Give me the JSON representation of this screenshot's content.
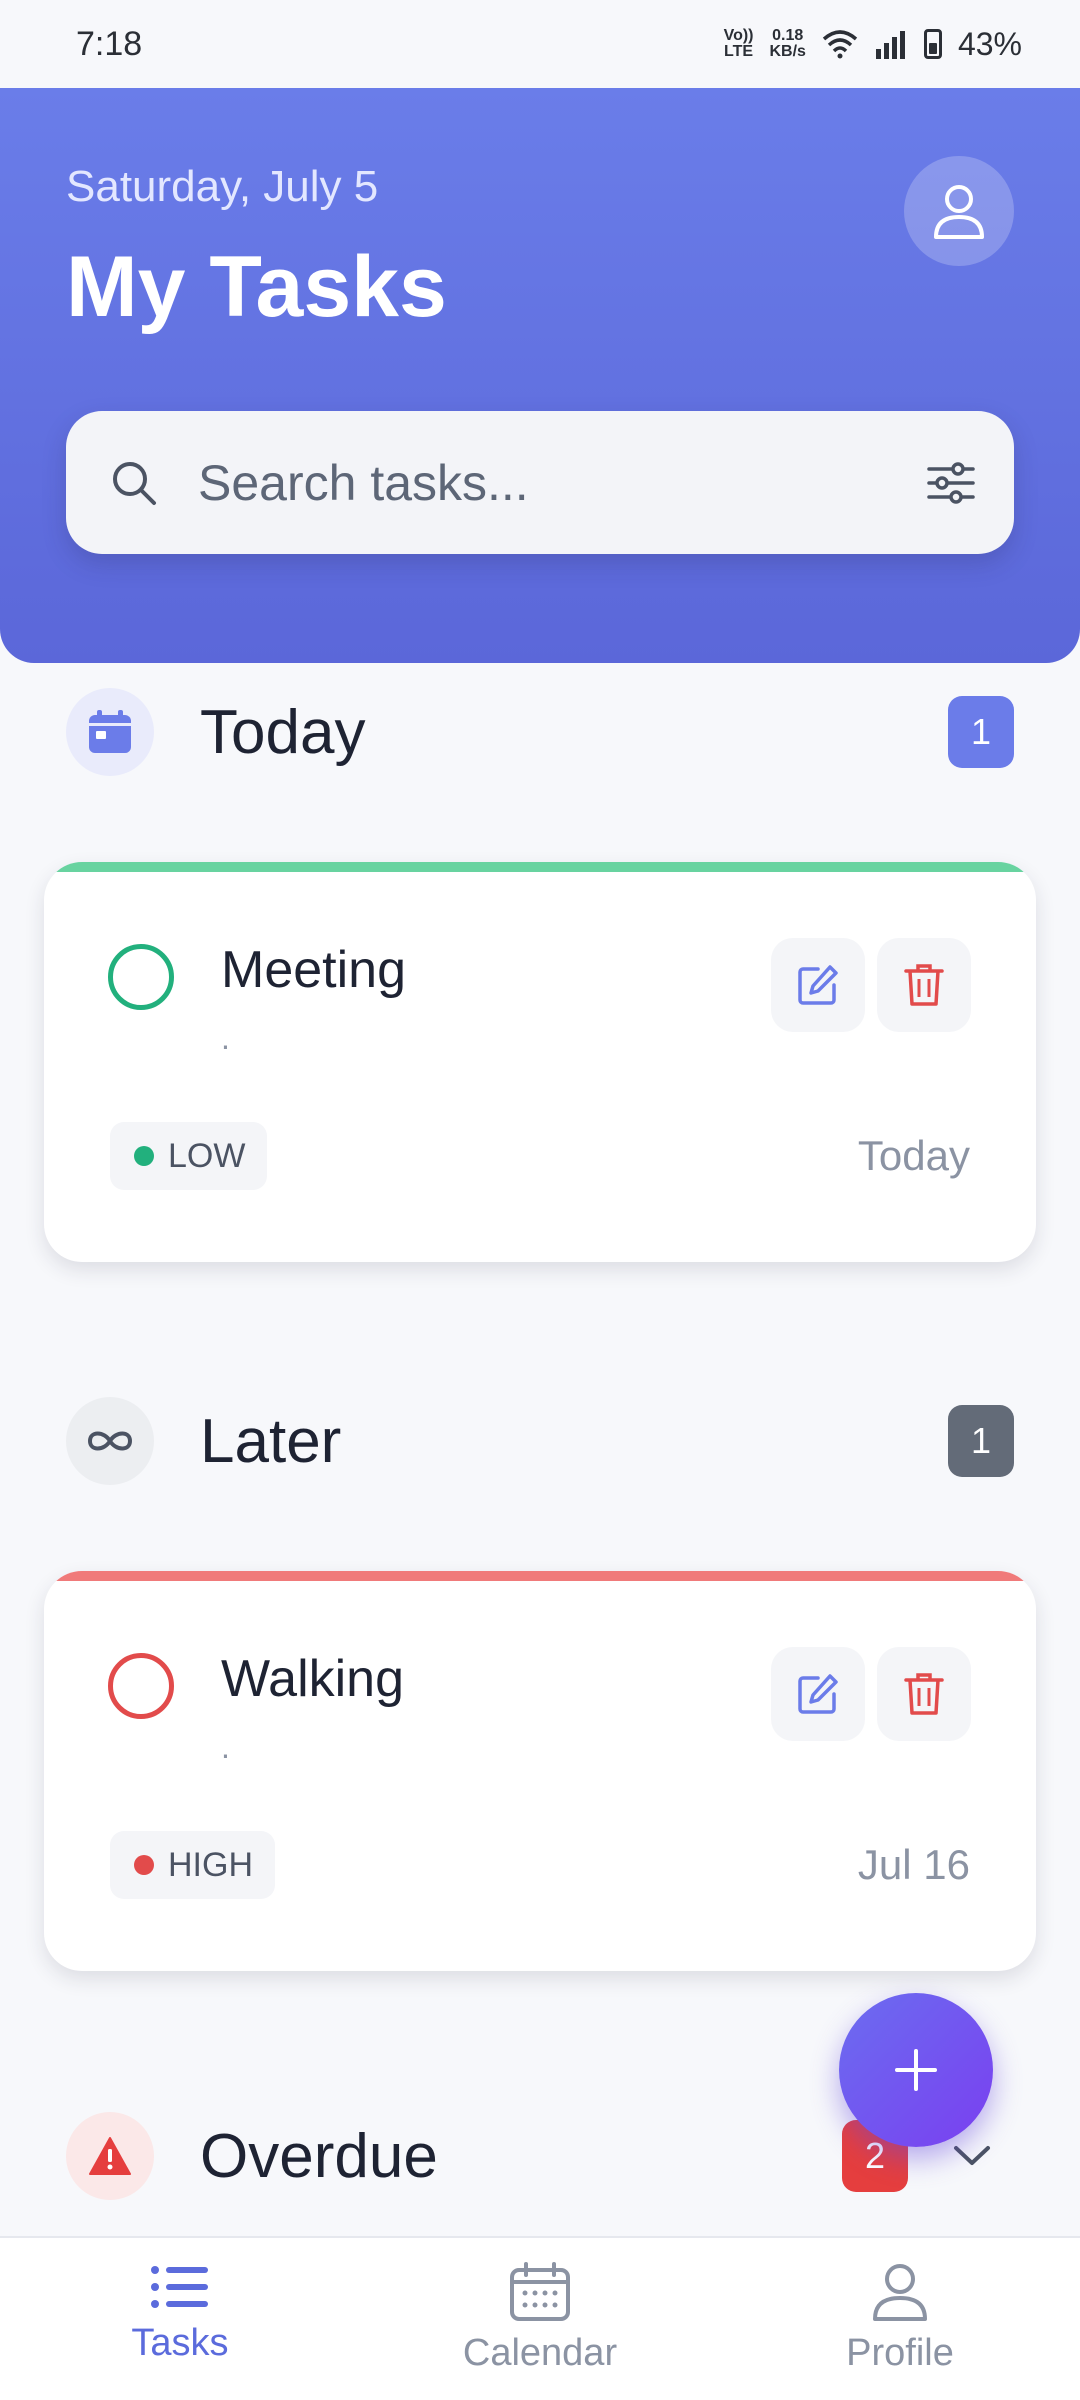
{
  "status_bar": {
    "time": "7:18",
    "net_type": "VoLTE",
    "speed_value": "0.18",
    "speed_unit": "KB/s",
    "battery": "43%"
  },
  "header": {
    "date": "Saturday, July 5",
    "title": "My Tasks",
    "search_placeholder": "Search tasks..."
  },
  "sections": {
    "today": {
      "label": "Today",
      "count": "1",
      "icon": "calendar-icon",
      "count_color": "#6b7ce9"
    },
    "later": {
      "label": "Later",
      "count": "1",
      "icon": "infinity-icon",
      "count_color": "#636b78"
    },
    "overdue": {
      "label": "Overdue",
      "count": "2",
      "icon": "warning-icon",
      "count_color": "#e53e3e"
    }
  },
  "tasks": [
    {
      "name": "Meeting",
      "description": ".",
      "priority": "LOW",
      "due": "Today",
      "accent": "#22b07d",
      "stripe": "#68d3a0"
    },
    {
      "name": "Walking",
      "description": ".",
      "priority": "HIGH",
      "due": "Jul 16",
      "accent": "#e24b4b",
      "stripe": "#f07a7a"
    }
  ],
  "nav": {
    "tasks": "Tasks",
    "calendar": "Calendar",
    "profile": "Profile",
    "active_color": "#5b6bdc",
    "inactive_color": "#8b93a3"
  }
}
